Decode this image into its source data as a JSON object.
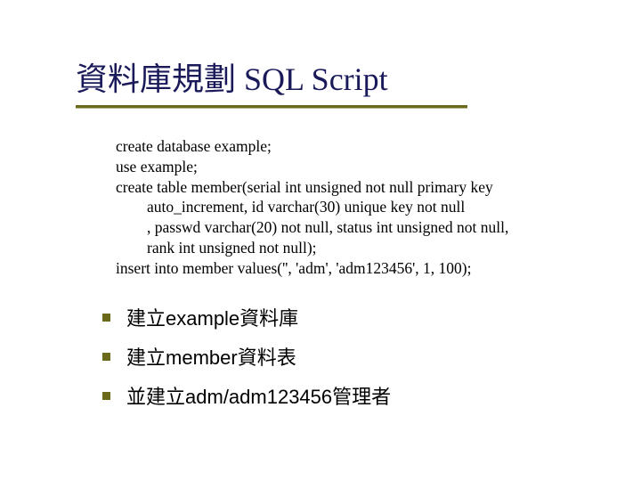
{
  "title": "資料庫規劃 SQL Script",
  "code": {
    "line1": "create database example;",
    "line2": "use example;",
    "line3": "create table member(serial int unsigned not null primary key",
    "line4": "        auto_increment, id varchar(30) unique key not null",
    "line5": "        , passwd varchar(20) not null, status int unsigned not null,",
    "line6": "        rank int unsigned not null);",
    "line7": "insert into member values('', 'adm', 'adm123456', 1, 100);"
  },
  "bullets": [
    {
      "pre": "建立",
      "mid": "example",
      "post": "資料庫"
    },
    {
      "pre": "建立",
      "mid": "member",
      "post": "資料表"
    },
    {
      "pre": "並建立",
      "mid": "adm/adm123456",
      "post": "管理者"
    }
  ]
}
